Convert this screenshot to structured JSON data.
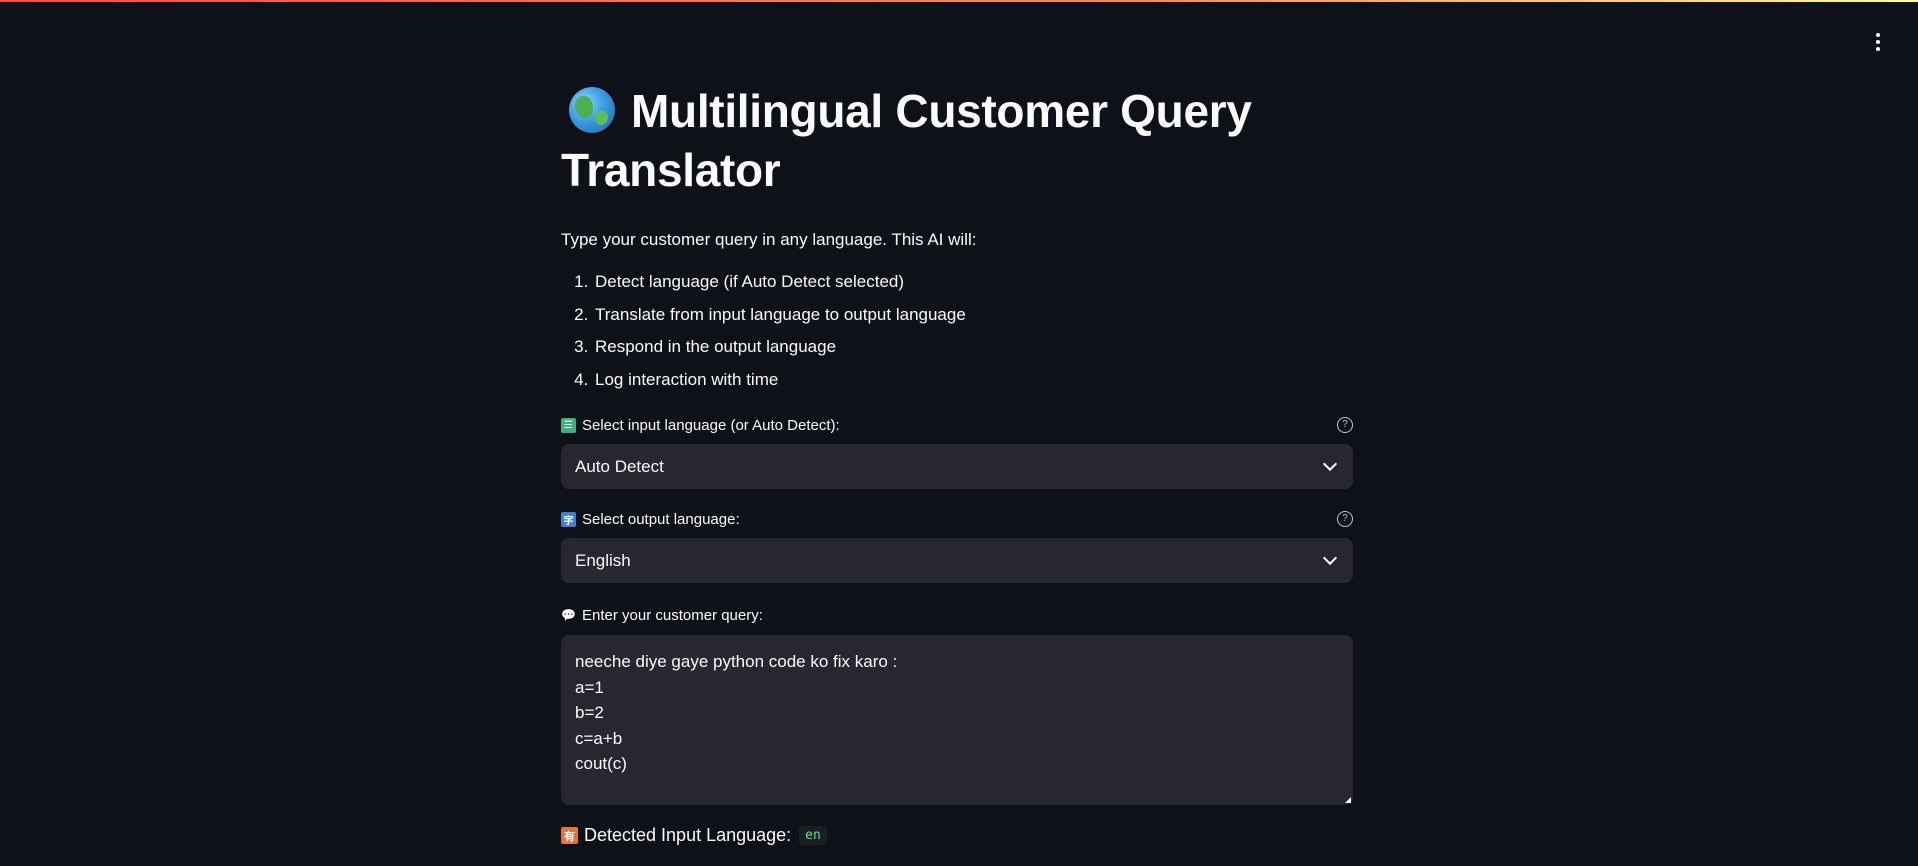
{
  "header": {
    "title_line1": "Multilingual Customer Query",
    "title_line2": "Translator"
  },
  "intro": {
    "description": "Type your customer query in any language. This AI will:",
    "steps": [
      "Detect language (if Auto Detect selected)",
      "Translate from input language to output language",
      "Respond in the output language",
      "Log interaction with time"
    ]
  },
  "input_language": {
    "label": "Select input language (or Auto Detect):",
    "icon": "input-symbols-icon",
    "selected": "Auto Detect",
    "help": "?"
  },
  "output_language": {
    "label": "Select output language:",
    "icon": "language-icon",
    "selected": "English",
    "help": "?"
  },
  "query": {
    "label": "Enter your customer query:",
    "icon": "speech-balloon-icon",
    "lines": [
      "neeche diye gaye python code ko fix karo :",
      "a=1",
      "b=2",
      "c=a+b",
      "cout(c)"
    ]
  },
  "detected": {
    "label": "Detected Input Language:",
    "icon": "symbols-icon",
    "code": "en"
  },
  "colors": {
    "background": "#0e1117",
    "widget": "#262730",
    "text": "#fafafa",
    "accent_red": "#ff4b4b",
    "code_green": "#5ce488"
  }
}
